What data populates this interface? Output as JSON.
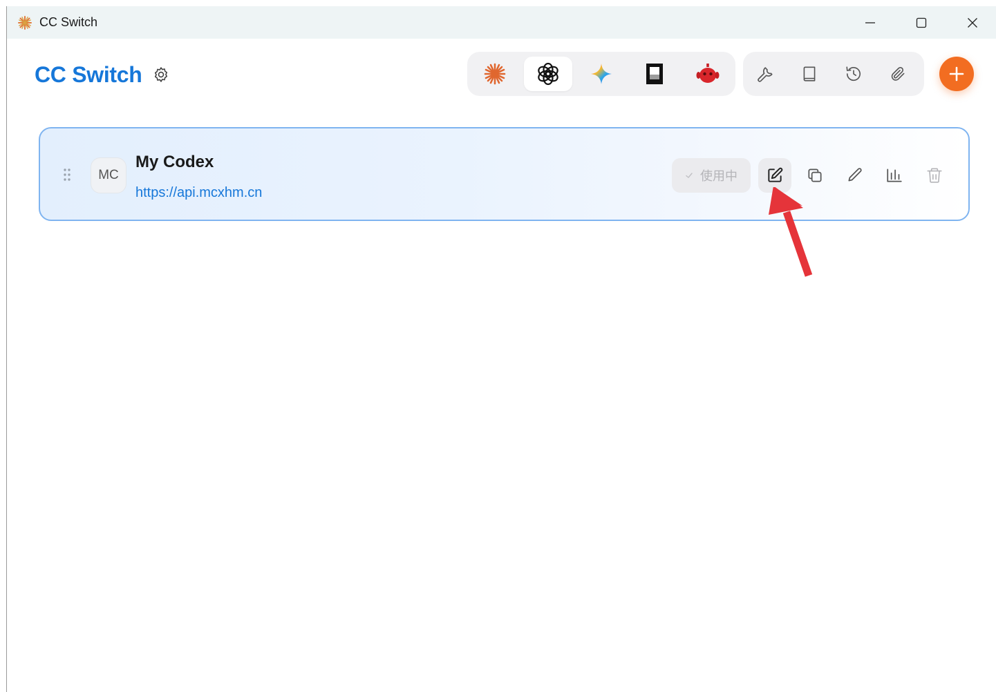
{
  "window": {
    "title": "CC Switch",
    "controls": [
      "minimize",
      "maximize",
      "close"
    ]
  },
  "header": {
    "title": "CC Switch",
    "settings_icon": "gear-icon"
  },
  "app_switcher": {
    "apps": [
      {
        "id": "claude",
        "icon": "claude-sunburst-icon",
        "active": false
      },
      {
        "id": "codex",
        "icon": "openai-icon",
        "active": true
      },
      {
        "id": "gemini",
        "icon": "gemini-sparkle-icon",
        "active": false
      },
      {
        "id": "opencode",
        "icon": "opencode-icon",
        "active": false
      },
      {
        "id": "bot",
        "icon": "red-bot-icon",
        "active": false
      }
    ]
  },
  "toolbar": {
    "tools": [
      {
        "id": "mcp",
        "icon": "wrench-icon"
      },
      {
        "id": "prompts",
        "icon": "book-icon"
      },
      {
        "id": "history",
        "icon": "history-icon"
      },
      {
        "id": "skills",
        "icon": "paperclip-icon"
      }
    ],
    "add_icon": "plus-icon"
  },
  "provider": {
    "avatar": "MC",
    "name": "My Codex",
    "url": "https://api.mcxhm.cn",
    "status_label": "使用中",
    "actions": [
      "edit-icon",
      "duplicate-icon",
      "pen-icon",
      "usage-chart-icon",
      "trash-icon"
    ]
  },
  "colors": {
    "brand_blue": "#1677d9",
    "add_orange": "#f26d21",
    "card_border": "#7fb4f0",
    "arrow_red": "#e5343a"
  }
}
